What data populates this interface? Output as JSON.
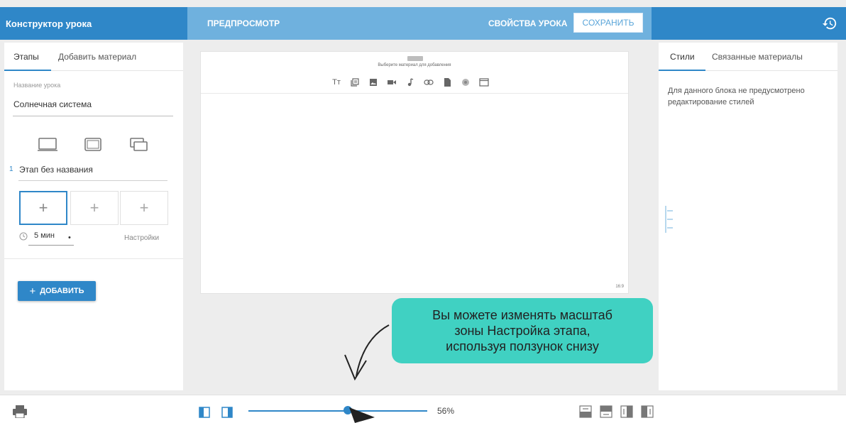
{
  "header": {
    "title": "Конструктор урока",
    "preview_label": "ПРЕДПРОСМОТР",
    "props_label": "СВОЙСТВА УРОКА",
    "save_label": "СОХРАНИТЬ",
    "history_icon": "history-icon"
  },
  "left_panel": {
    "tabs": [
      {
        "label": "Этапы",
        "active": true
      },
      {
        "label": "Добавить материал",
        "active": false
      }
    ],
    "lesson_name_label": "Название урока",
    "lesson_name_value": "Солнечная система",
    "device_icons": [
      "desktop-icon",
      "tablet-icon",
      "multi-screen-icon"
    ],
    "stage": {
      "number": "1",
      "name": "Этап без названия",
      "slots": [
        "+",
        "+",
        "+"
      ],
      "time_value": "5 мин",
      "time_caret": "•",
      "settings_label": "Настройки"
    },
    "add_button_label": "ДОБАВИТЬ",
    "add_button_plus": "+"
  },
  "canvas": {
    "choose_label": "Выберите материал для добавления",
    "material_icons": [
      "text-icon",
      "gallery-icon",
      "image-icon",
      "video-icon",
      "audio-icon",
      "link-icon",
      "document-icon",
      "3d-icon",
      "window-icon"
    ],
    "text_icon_glyph": "Tт",
    "ratio_label": "16:9"
  },
  "tooltip": {
    "lines": [
      "Вы можете изменять масштаб",
      "зоны Настройка этапа,",
      "используя ползунок снизу"
    ]
  },
  "right_panel": {
    "tabs": [
      {
        "label": "Стили",
        "active": true
      },
      {
        "label": "Связанные материалы",
        "active": false
      }
    ],
    "message": "Для данного блока не предусмотрено редактирование стилей"
  },
  "bottom_bar": {
    "zoom": 56,
    "zoom_label": "56%",
    "accent": "#2f87c8"
  },
  "colors": {
    "primary": "#2f87c8",
    "header_light": "#6fb1de",
    "tooltip": "#40d1c2"
  }
}
